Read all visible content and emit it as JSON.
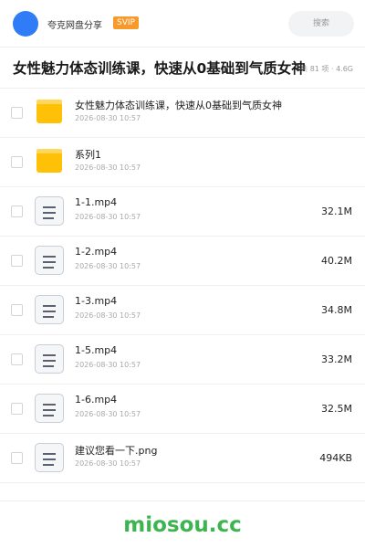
{
  "header": {
    "user_name": "夸克网盘分享",
    "badge": "SVIP",
    "search_placeholder": "搜索",
    "accent_color": "#2f7cf6",
    "badge_color": "#f79a2b"
  },
  "share": {
    "title": "女性魅力体态训练课，快速从0基础到气质女神",
    "meta": "共 81 项 · 4.6G"
  },
  "files": [
    {
      "icon": "folder-icon",
      "name": "女性魅力体态训练课，快速从0基础到气质女神",
      "date": "2026-08-30 10:57",
      "size": ""
    },
    {
      "icon": "folder-icon",
      "name": "系列1",
      "date": "2026-08-30 10:57",
      "size": ""
    },
    {
      "icon": "document-icon",
      "name": "1-1.mp4",
      "date": "2026-08-30 10:57",
      "size": "32.1M"
    },
    {
      "icon": "document-icon",
      "name": "1-2.mp4",
      "date": "2026-08-30 10:57",
      "size": "40.2M"
    },
    {
      "icon": "document-icon",
      "name": "1-3.mp4",
      "date": "2026-08-30 10:57",
      "size": "34.8M"
    },
    {
      "icon": "document-icon",
      "name": "1-5.mp4",
      "date": "2026-08-30 10:57",
      "size": "33.2M"
    },
    {
      "icon": "document-icon",
      "name": "1-6.mp4",
      "date": "2026-08-30 10:57",
      "size": "32.5M"
    },
    {
      "icon": "document-icon",
      "name": "建议您看一下.png",
      "date": "2026-08-30 10:57",
      "size": "494KB"
    }
  ],
  "footer": {
    "watermark": "miosou.cc",
    "watermark_color": "#3cb450"
  }
}
